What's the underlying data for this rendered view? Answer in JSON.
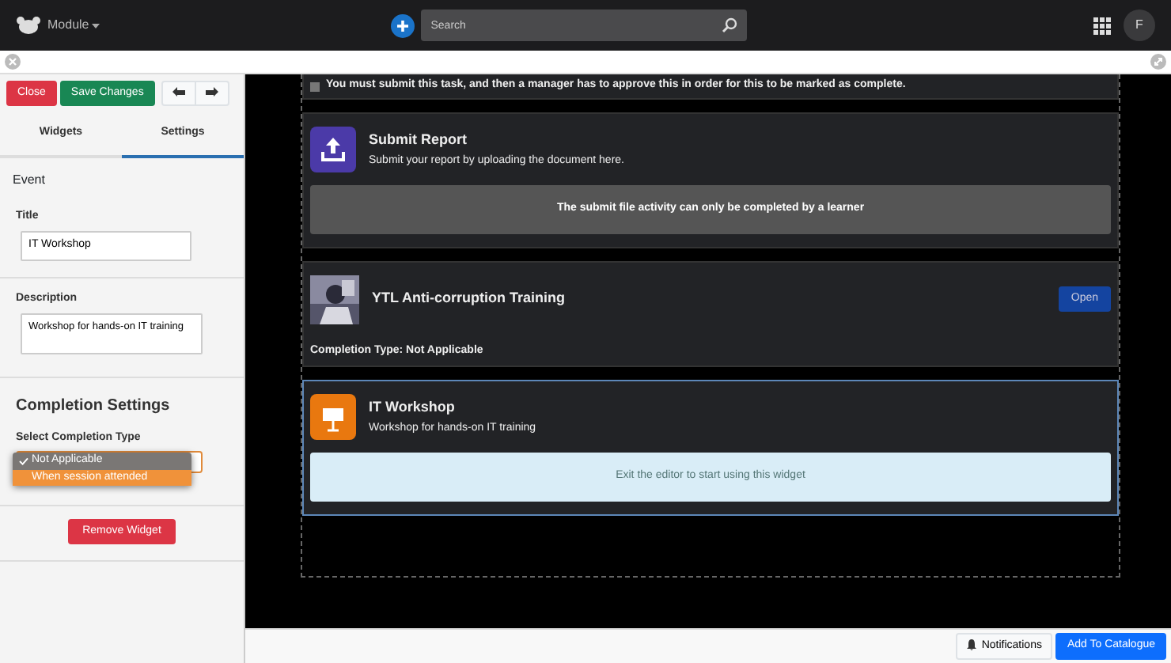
{
  "navbar": {
    "title": "Module",
    "search": {
      "placeholder": "Search"
    },
    "avatar": "F"
  },
  "sidebar": {
    "buttons": [
      {
        "label": "Close",
        "kind": "danger"
      },
      {
        "label": "Save Changes",
        "kind": "success"
      }
    ],
    "tabs": [
      {
        "label": "Widgets",
        "selected": false
      },
      {
        "label": "Settings",
        "selected": true
      }
    ],
    "section": "Event",
    "fields": [
      {
        "label": "Title",
        "kind": "input",
        "value": "IT Workshop"
      },
      {
        "label": "Description",
        "kind": "textarea",
        "value": "Workshop for hands-on IT training"
      }
    ],
    "completion": {
      "heading": "Completion Settings",
      "label": "Select Completion Type",
      "options": [
        {
          "label": "Not Applicable",
          "checked": true,
          "highlighted": false
        },
        {
          "label": "When session attended",
          "checked": false,
          "highlighted": true
        }
      ]
    },
    "remove_button": "Remove Widget"
  },
  "canvas": {
    "widgets": [
      {
        "kind": "notice",
        "selected": false,
        "checked": false,
        "text": "You must submit this task, and then a manager has to approve this in order for this to be marked as complete."
      },
      {
        "kind": "submit",
        "selected": false,
        "title": "Submit Report",
        "description": "Submit your report by uploading the document here.",
        "message": "The submit file activity can only be completed by a learner"
      },
      {
        "kind": "course",
        "selected": false,
        "title": "YTL Anti-corruption Training",
        "button": "Open",
        "completion": "Completion Type: Not Applicable"
      },
      {
        "kind": "event",
        "selected": true,
        "title": "IT Workshop",
        "description": "Workshop for hands-on IT training",
        "message": "Exit the editor to start using this widget"
      }
    ]
  },
  "footer": {
    "buttons": [
      {
        "label": "Notifications",
        "kind": "light"
      },
      {
        "label": "Add To Catalogue",
        "kind": "primary"
      }
    ]
  }
}
